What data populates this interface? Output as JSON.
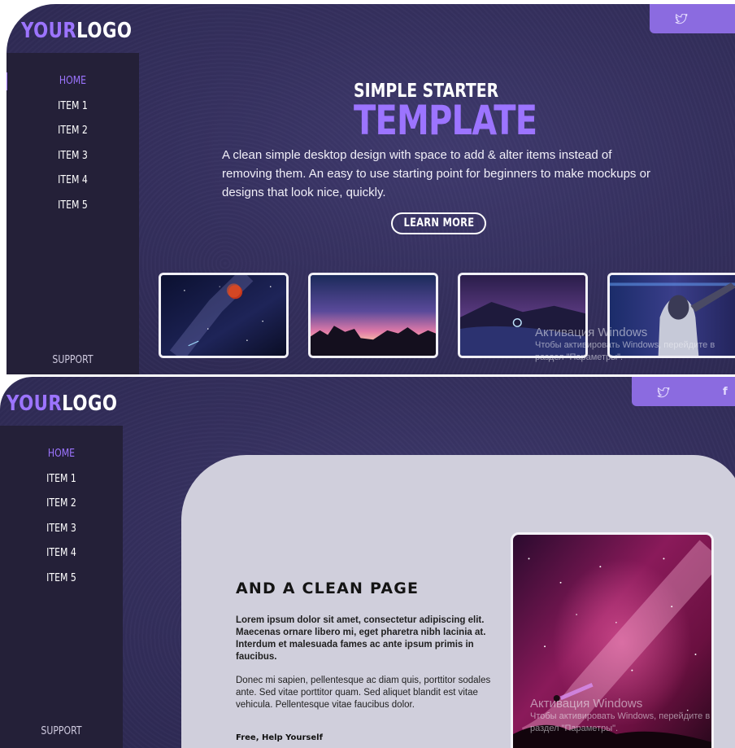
{
  "colors": {
    "accent": "#9c74ff",
    "sidebar": "#242038",
    "background": "#36315f",
    "card": "#d0cfdc"
  },
  "icons": {
    "social": [
      "twitter-icon",
      "facebook-icon"
    ]
  },
  "logo": {
    "part1": "YOUR",
    "part2": "LOGO"
  },
  "nav": {
    "home": "HOME",
    "items": [
      "ITEM 1",
      "ITEM 2",
      "ITEM 3",
      "ITEM 4",
      "ITEM  5"
    ],
    "support": "SUPPORT"
  },
  "hero": {
    "subtitle": "SIMPLE STARTER",
    "title": "TEMPLATE",
    "description": "A clean simple desktop design with space to add & alter items instead of removing them. An easy to use starting point for beginners to make mockups or designs that look nice, quickly.",
    "button": "LEARN MORE"
  },
  "content": {
    "heading": "AND A CLEAN PAGE",
    "para1": "Lorem ipsum dolor sit amet, consectetur adipiscing elit. Maecenas ornare libero mi, eget pharetra nibh lacinia at. Interdum et malesuada fames ac ante ipsum primis in faucibus.",
    "para2": "Donec mi sapien, pellentesque ac diam quis, porttitor sodales ante. Sed vitae porttitor quam. Sed aliquet blandit est vitae vehicula. Pellentesque vitae faucibus dolor.",
    "para3_heading": "Free, Help Yourself"
  },
  "watermark": {
    "title": "Активация Windows",
    "line1": "Чтобы активировать Windows, перейдите в",
    "line2": "раздел \"Параметры\"."
  }
}
